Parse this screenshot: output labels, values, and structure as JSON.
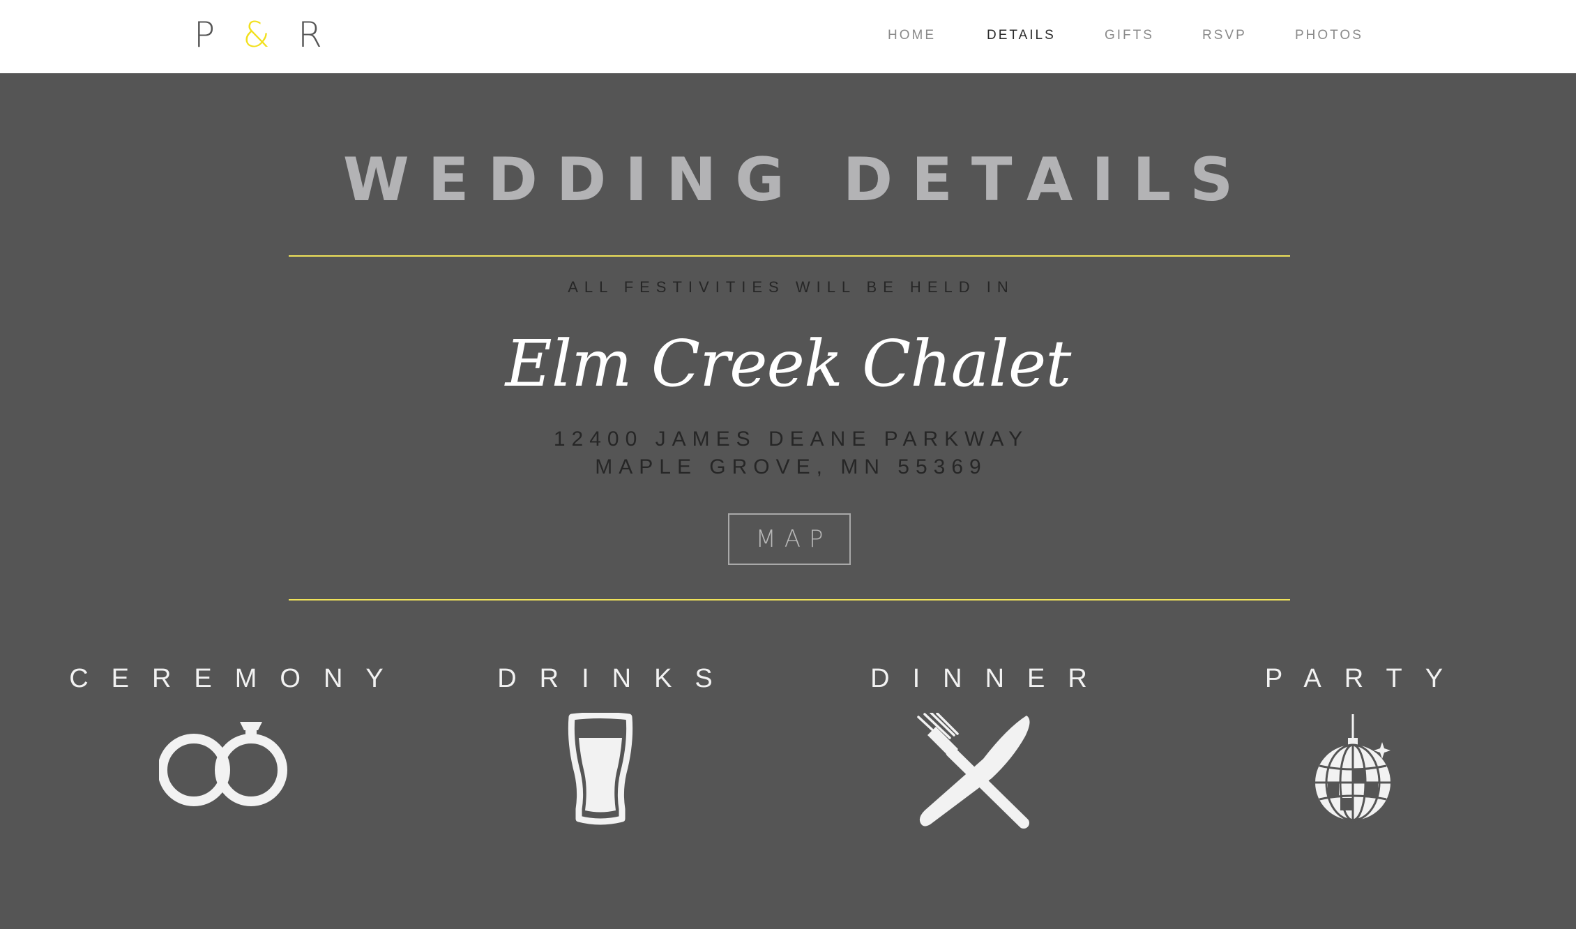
{
  "header": {
    "logo": {
      "left": "P",
      "amp": "&",
      "right": "R"
    },
    "nav": [
      {
        "label": "HOME",
        "active": false
      },
      {
        "label": "DETAILS",
        "active": true
      },
      {
        "label": "GIFTS",
        "active": false
      },
      {
        "label": "RSVP",
        "active": false
      },
      {
        "label": "PHOTOS",
        "active": false
      }
    ]
  },
  "main": {
    "title": "WEDDING DETAILS",
    "kicker": "ALL FESTIVITIES WILL BE HELD IN",
    "venue": "Elm Creek Chalet",
    "address_line1": "12400 JAMES DEANE PARKWAY",
    "address_line2": "MAPLE GROVE, MN 55369",
    "map_button": "MAP"
  },
  "categories": [
    {
      "label": "CEREMONY",
      "icon": "rings-icon"
    },
    {
      "label": "DRINKS",
      "icon": "beer-glass-icon"
    },
    {
      "label": "DINNER",
      "icon": "fork-knife-icon"
    },
    {
      "label": "PARTY",
      "icon": "disco-ball-icon"
    }
  ],
  "colors": {
    "background": "#555555",
    "header": "#ffffff",
    "accent": "#f2e01c",
    "rule": "#f0e35a",
    "title": "#b3b3b5",
    "icon": "#f2f2f2"
  }
}
